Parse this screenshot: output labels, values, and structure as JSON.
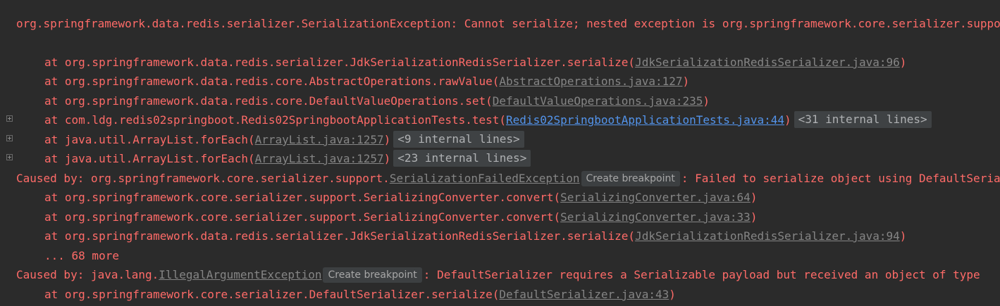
{
  "console": {
    "lines": [
      {
        "text": "org.springframework.data.redis.serializer.SerializationException: Cannot serialize; nested exception is org.springframework.core.serializer.support.SerializationFailedException: Failed to serialize object using DefaultSerializer; nested exception is java.lang.IllegalArgumentException: DefaultSerializer requires a Serializable payload but received an object of type"
      },
      {
        "prefix": "at org.springframework.data.redis.serializer.JdkSerializationRedisSerializer.serialize(",
        "link": "JdkSerializationRedisSerializer.java:96",
        "suffix": ")"
      },
      {
        "prefix": "at org.springframework.data.redis.core.AbstractOperations.rawValue(",
        "link": "AbstractOperations.java:127",
        "suffix": ")"
      },
      {
        "prefix": "at org.springframework.data.redis.core.DefaultValueOperations.set(",
        "link": "DefaultValueOperations.java:235",
        "suffix": ")"
      },
      {
        "prefix": "at com.ldg.redis02springboot.Redis02SpringbootApplicationTests.test(",
        "link": "Redis02SpringbootApplicationTests.java:44",
        "suffix": ")",
        "badge": "<31 internal lines>"
      },
      {
        "prefix": "at java.util.ArrayList.forEach(",
        "link": "ArrayList.java:1257",
        "suffix": ")",
        "badge": "<9 internal lines>"
      },
      {
        "prefix": "at java.util.ArrayList.forEach(",
        "link": "ArrayList.java:1257",
        "suffix": ")",
        "badge": "<23 internal lines>"
      },
      {
        "prefix": "Caused by: org.springframework.core.serializer.support.",
        "link": "SerializationFailedException",
        "breakpoint": "Create breakpoint",
        "suffix": ": Failed to serialize object using DefaultSerializer; nested exception is java.lang.IllegalArgumentException"
      },
      {
        "prefix": "at org.springframework.core.serializer.support.SerializingConverter.convert(",
        "link": "SerializingConverter.java:64",
        "suffix": ")"
      },
      {
        "prefix": "at org.springframework.core.serializer.support.SerializingConverter.convert(",
        "link": "SerializingConverter.java:33",
        "suffix": ")"
      },
      {
        "prefix": "at org.springframework.data.redis.serializer.JdkSerializationRedisSerializer.serialize(",
        "link": "JdkSerializationRedisSerializer.java:94",
        "suffix": ")"
      },
      {
        "text": "... 68 more"
      },
      {
        "prefix": "Caused by: java.lang.",
        "link": "IllegalArgumentException",
        "breakpoint": "Create breakpoint",
        "suffix": ": DefaultSerializer requires a Serializable payload but received an object of type"
      },
      {
        "prefix": "at org.springframework.core.serializer.DefaultSerializer.serialize(",
        "link": "DefaultSerializer.java:43",
        "suffix": ")"
      }
    ]
  },
  "colors": {
    "background": "#2b2b2b",
    "error_text": "#ff6b68",
    "file_link": "#858585",
    "project_link": "#5394ec",
    "badge_bg": "#3f4244"
  },
  "icons": {
    "fold": "plus-square-icon"
  }
}
